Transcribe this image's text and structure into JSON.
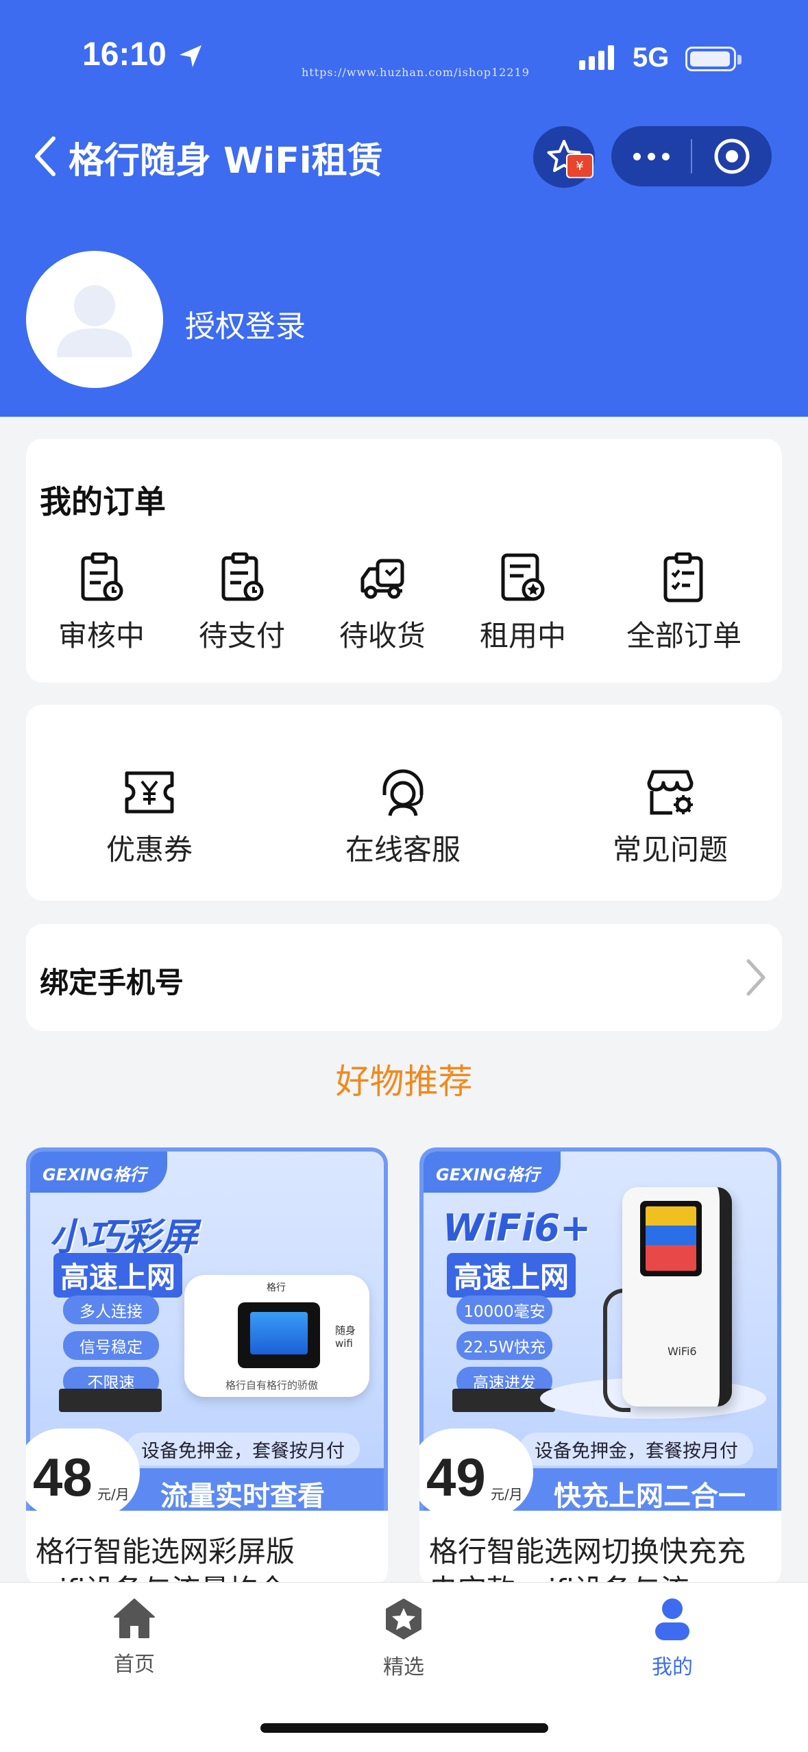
{
  "status_bar": {
    "time": "16:10",
    "network": "5G",
    "watermark": "https://www.huzhan.com/ishop12219"
  },
  "nav": {
    "title": "格行随身 WiFi租赁"
  },
  "profile": {
    "login_text": "授权登录"
  },
  "orders": {
    "title": "我的订单",
    "items": [
      {
        "label": "审核中",
        "icon": "clipboard-clock-icon"
      },
      {
        "label": "待支付",
        "icon": "clipboard-pay-icon"
      },
      {
        "label": "待收货",
        "icon": "delivery-truck-icon"
      },
      {
        "label": "租用中",
        "icon": "document-star-icon"
      },
      {
        "label": "全部订单",
        "icon": "clipboard-list-icon"
      }
    ]
  },
  "services": {
    "items": [
      {
        "label": "优惠券",
        "icon": "coupon-yen-icon"
      },
      {
        "label": "在线客服",
        "icon": "customer-service-icon"
      },
      {
        "label": "常见问题",
        "icon": "shop-gear-icon"
      }
    ]
  },
  "bind_phone": {
    "label": "绑定手机号"
  },
  "recommend": {
    "title": "好物推荐"
  },
  "products": [
    {
      "brand": "GEXING格行",
      "headline1": "小巧彩屏",
      "headline2": "高速上网",
      "tags": [
        "多人连接",
        "信号稳定",
        "不限速"
      ],
      "deposit_note": "设备免押金，套餐按月付",
      "price": "48",
      "unit": "元/月",
      "slogan": "流量实时查看",
      "name_line1": "格行智能选网彩屏版",
      "name_line2": "wifi设备与流量均全"
    },
    {
      "brand": "GEXING格行",
      "headline1": "WiFi6+",
      "headline2": "高速上网",
      "tags": [
        "10000毫安",
        "22.5W快充",
        "高速进发"
      ],
      "deposit_note": "设备免押金，套餐按月付",
      "price": "49",
      "unit": "元/月",
      "slogan": "快充上网二合一",
      "name_line1": "格行智能选网切换快充充",
      "name_line2": "电宝款 wifi设备与流"
    }
  ],
  "tabbar": {
    "items": [
      {
        "label": "首页",
        "icon": "home-icon",
        "active": false
      },
      {
        "label": "精选",
        "icon": "star-badge-icon",
        "active": false
      },
      {
        "label": "我的",
        "icon": "user-icon",
        "active": true
      }
    ]
  },
  "colors": {
    "primary": "#3d6cf0",
    "accent": "#f08a1c",
    "background": "#f3f4f6"
  }
}
